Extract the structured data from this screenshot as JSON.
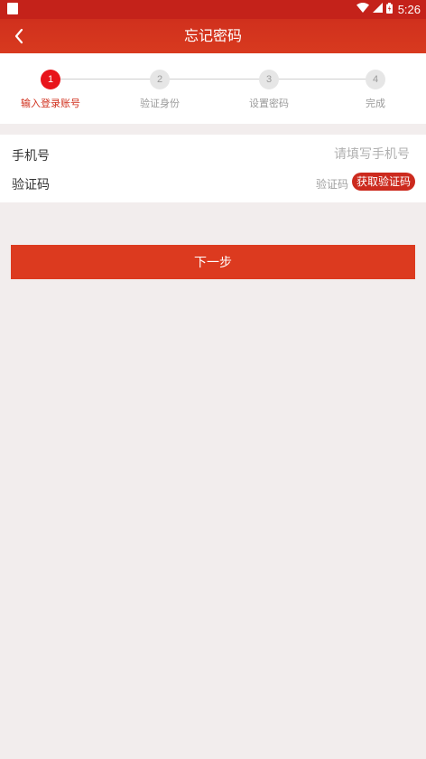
{
  "status_bar": {
    "time": "5:26",
    "icons": [
      "notification-square-icon",
      "wifi-icon",
      "signal-icon",
      "battery-icon"
    ]
  },
  "app_bar": {
    "title": "忘记密码",
    "back_icon": "chevron-left-icon"
  },
  "steps": [
    {
      "number": "1",
      "label": "输入登录账号",
      "active": true
    },
    {
      "number": "2",
      "label": "验证身份",
      "active": false
    },
    {
      "number": "3",
      "label": "设置密码",
      "active": false
    },
    {
      "number": "4",
      "label": "完成",
      "active": false
    }
  ],
  "form": {
    "phone": {
      "label": "手机号",
      "placeholder": "请填写手机号",
      "value": ""
    },
    "code": {
      "label": "验证码",
      "placeholder": "验证码",
      "value": "",
      "button_label": "获取验证码"
    }
  },
  "actions": {
    "next_label": "下一步"
  },
  "colors": {
    "primary": "#d83a1f",
    "active_step": "#e8141b",
    "background": "#f2eded"
  }
}
